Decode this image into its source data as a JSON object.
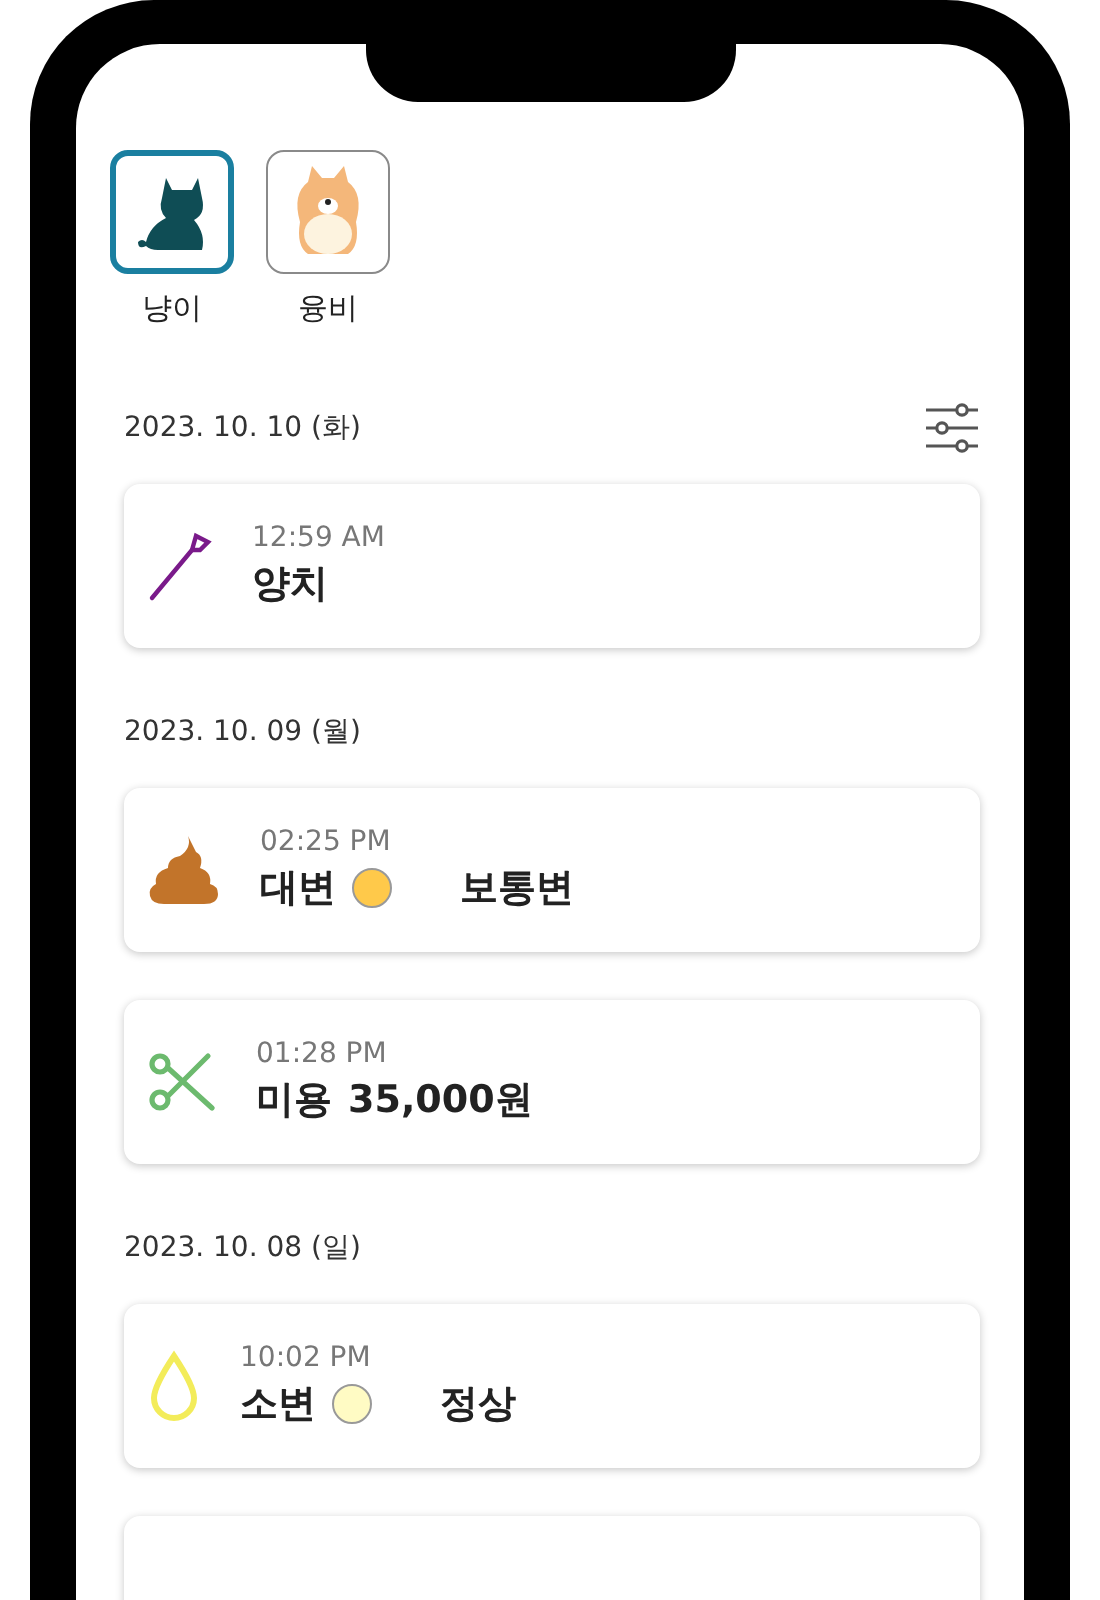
{
  "pets": [
    {
      "name": "냥이",
      "kind": "cat",
      "selected": true
    },
    {
      "name": "융비",
      "kind": "dog",
      "selected": false
    }
  ],
  "days": [
    {
      "date": "2023. 10. 10 (화)",
      "filter": true,
      "records": [
        {
          "kind": "brushing",
          "time": "12:59 AM",
          "title": "양치"
        }
      ]
    },
    {
      "date": "2023. 10. 09 (월)",
      "filter": false,
      "records": [
        {
          "kind": "poop",
          "time": "02:25 PM",
          "title": "대변",
          "color": "#ffc94a",
          "note": "보통변"
        },
        {
          "kind": "grooming",
          "time": "01:28 PM",
          "title": "미용",
          "amount": "35,000원"
        }
      ]
    },
    {
      "date": "2023. 10. 08 (일)",
      "filter": false,
      "records": [
        {
          "kind": "pee",
          "time": "10:02 PM",
          "title": "소변",
          "color": "#fffbc4",
          "note": "정상"
        },
        {
          "kind": "cut_off"
        }
      ]
    }
  ]
}
